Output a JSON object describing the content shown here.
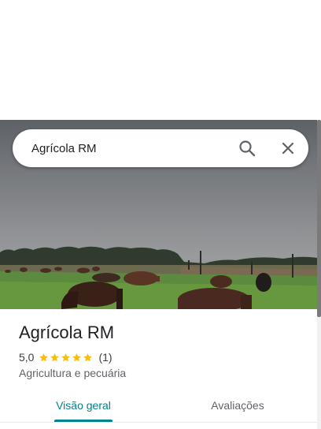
{
  "search": {
    "value": "Agrícola RM",
    "search_icon": "search-icon",
    "close_icon": "close-icon"
  },
  "hero": {
    "image": "photo-cattle-grazing-pasture"
  },
  "place": {
    "title": "Agrícola RM",
    "rating_value": "5,0",
    "rating_stars": 5,
    "rating_count": "(1)",
    "category": "Agricultura e pecuária"
  },
  "tabs": [
    {
      "label": "Visão geral",
      "selected": true
    },
    {
      "label": "Avaliações",
      "selected": false
    }
  ],
  "colors": {
    "accent": "#00838f",
    "star": "#fbbc04",
    "text_primary": "#202124",
    "text_secondary": "#5f6368"
  }
}
